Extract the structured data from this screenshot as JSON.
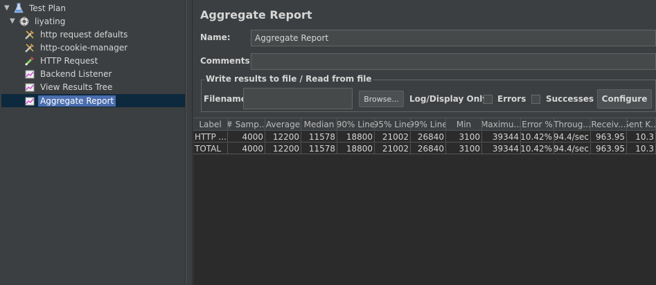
{
  "tree": {
    "items": [
      {
        "label": "Test Plan",
        "icon": "test-plan-icon"
      },
      {
        "label": "liyating",
        "icon": "thread-group-icon"
      },
      {
        "label": "http request defaults",
        "icon": "config-icon"
      },
      {
        "label": "http-cookie-manager",
        "icon": "config-icon"
      },
      {
        "label": "HTTP Request",
        "icon": "sampler-icon"
      },
      {
        "label": "Backend Listener",
        "icon": "listener-icon"
      },
      {
        "label": "View Results Tree",
        "icon": "listener-icon"
      },
      {
        "label": "Aggregate Report",
        "icon": "listener-icon"
      }
    ]
  },
  "panel": {
    "title": "Aggregate Report",
    "name_label": "Name:",
    "name_value": "Aggregate Report",
    "comments_label": "Comments:",
    "comments_value": "",
    "group_title": "Write results to file / Read from file",
    "filename_label": "Filename",
    "filename_value": "",
    "browse_label": "Browse...",
    "log_display_label": "Log/Display Only:",
    "errors_label": "Errors",
    "successes_label": "Successes",
    "configure_label": "Configure"
  },
  "table": {
    "columns": [
      "Label",
      "# Samp...",
      "Average",
      "Median",
      "90% Line",
      "95% Line",
      "99% Line",
      "Min",
      "Maximu...",
      "Error %",
      "Throug...",
      "Receiv...",
      "Sent K..."
    ],
    "rows": [
      [
        "HTTP ...",
        "4000",
        "12200",
        "11578",
        "18800",
        "21002",
        "26840",
        "3100",
        "39344",
        "10.42%",
        "94.4/sec",
        "963.95",
        "10.3"
      ],
      [
        "TOTAL",
        "4000",
        "12200",
        "11578",
        "18800",
        "21002",
        "26840",
        "3100",
        "39344",
        "10.42%",
        "94.4/sec",
        "963.95",
        "10.3"
      ]
    ]
  },
  "colors": {
    "background": "#3c3f41",
    "table_background": "#2b2b2b",
    "selection": "#4b6eaf"
  }
}
